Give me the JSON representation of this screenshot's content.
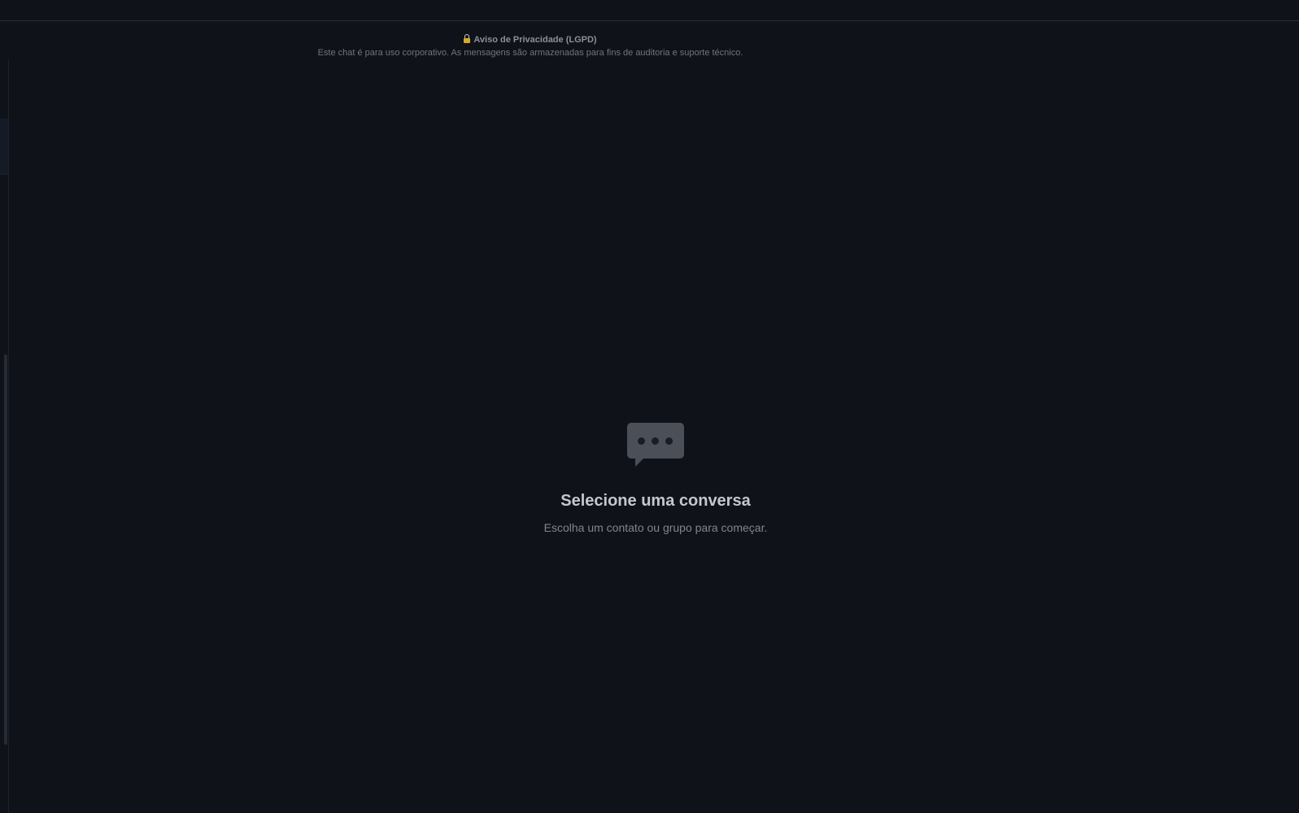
{
  "privacy_notice": {
    "title": "Aviso de Privacidade (LGPD)",
    "text": "Este chat é para uso corporativo. As mensagens são armazenadas para fins de auditoria e suporte técnico.",
    "icon": "lock-icon"
  },
  "empty_state": {
    "icon": "chat-bubble-icon",
    "title": "Selecione uma conversa",
    "subtitle": "Escolha um contato ou grupo para começar."
  },
  "colors": {
    "background": "#0f1218",
    "border": "#2a2f38",
    "icon": "#4b5058",
    "lock": "#d6a928"
  }
}
